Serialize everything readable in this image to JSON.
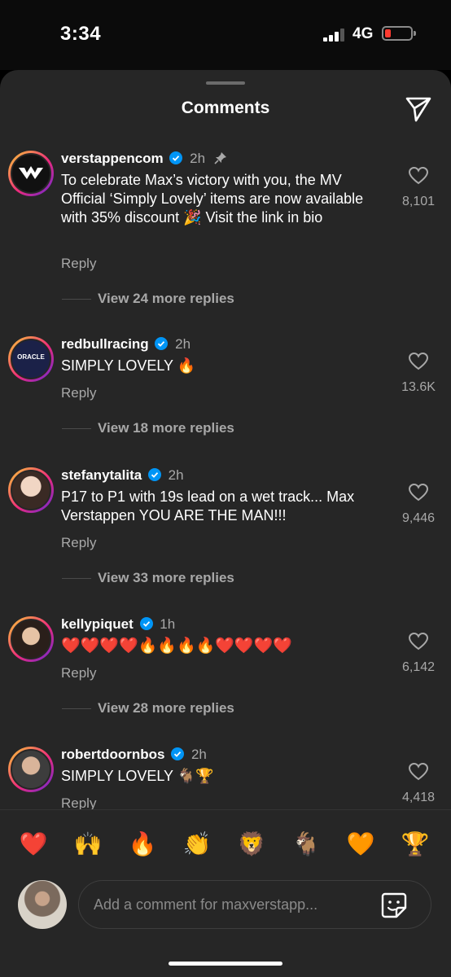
{
  "status_bar": {
    "time": "3:34",
    "network": "4G",
    "battery_color": "#ff3b30"
  },
  "sheet": {
    "title": "Comments"
  },
  "comments": [
    {
      "username": "verstappencom",
      "verified": true,
      "time": "2h",
      "pinned": true,
      "avatar_label": "MV",
      "text": "To celebrate Max’s victory with you, the MV Official ‘Simply Lovely’ items are now available with 35% discount 🎉 Visit the link in bio",
      "reply_label": "Reply",
      "likes": "8,101",
      "view_replies": "View 24 more replies"
    },
    {
      "username": "redbullracing",
      "verified": true,
      "time": "2h",
      "pinned": false,
      "avatar_label": "ORACLE",
      "text": "SIMPLY LOVELY 🔥",
      "reply_label": "Reply",
      "likes": "13.6K",
      "view_replies": "View 18 more replies"
    },
    {
      "username": "stefanytalita",
      "verified": true,
      "time": "2h",
      "pinned": false,
      "text": "P17 to P1 with 19s lead on a wet track... Max Verstappen YOU ARE THE MAN!!!",
      "reply_label": "Reply",
      "likes": "9,446",
      "view_replies": "View 33 more replies"
    },
    {
      "username": "kellypiquet",
      "verified": true,
      "time": "1h",
      "pinned": false,
      "text": "❤️❤️❤️❤️🔥🔥🔥🔥❤️❤️❤️❤️",
      "reply_label": "Reply",
      "likes": "6,142",
      "view_replies": "View 28 more replies"
    },
    {
      "username": "robertdoornbos",
      "verified": true,
      "time": "2h",
      "pinned": false,
      "text": "SIMPLY LOVELY 🐐🏆",
      "reply_label": "Reply",
      "likes": "4,418"
    }
  ],
  "emoji_bar": [
    "❤️",
    "🙌",
    "🔥",
    "👏",
    "🦁",
    "🐐",
    "🧡",
    "🏆"
  ],
  "composer": {
    "placeholder": "Add a comment for maxverstapp..."
  },
  "icons": {
    "send": "paper-plane-icon",
    "heart": "heart-outline-icon",
    "verified": "verified-badge-icon",
    "pin": "pin-icon",
    "sticker": "sticker-icon"
  },
  "colors": {
    "verified": "#0095f6",
    "sheet_bg": "#262626",
    "secondary_text": "#a8a8a8"
  }
}
